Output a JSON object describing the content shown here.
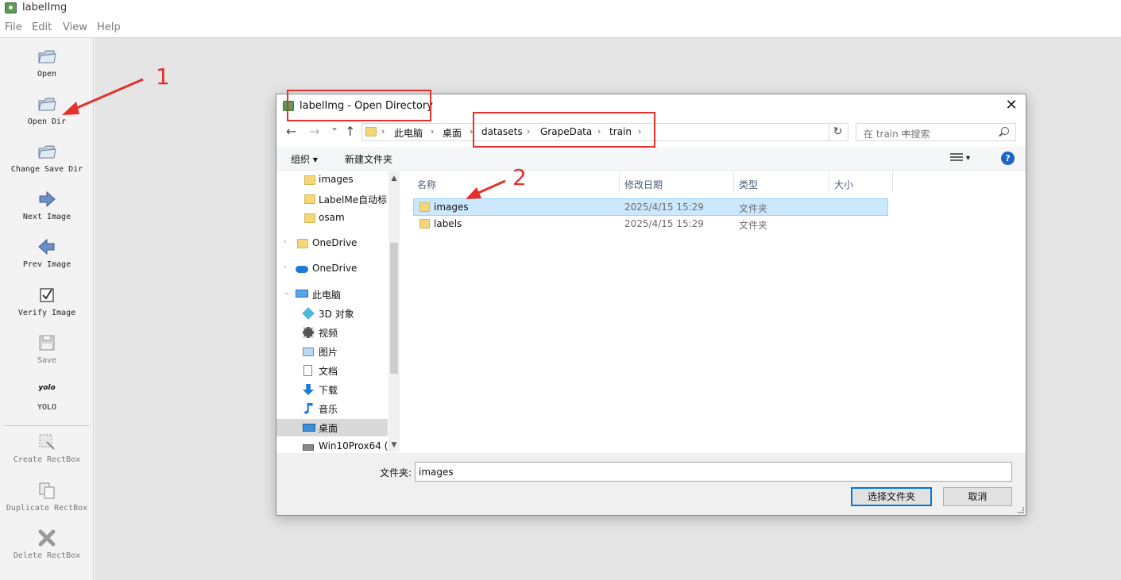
{
  "app": {
    "title": "labelImg"
  },
  "menu": [
    "File",
    "Edit",
    "View",
    "Help"
  ],
  "toolbar": {
    "open": "Open",
    "open_dir": "Open Dir",
    "change_save_dir": "Change Save Dir",
    "next_image": "Next Image",
    "prev_image": "Prev Image",
    "verify_image": "Verify Image",
    "save": "Save",
    "yolo_badge": "yolo",
    "yolo": "YOLO",
    "create_rectbox": "Create RectBox",
    "duplicate_rectbox": "Duplicate RectBox",
    "delete_rectbox": "Delete RectBox"
  },
  "dialog": {
    "title": "labelImg - Open Directory",
    "close": "✕",
    "nav": {
      "back": "←",
      "forward": "→",
      "recent": "⌄",
      "up": "↑"
    },
    "breadcrumb": [
      "此电脑",
      "桌面",
      "datasets",
      "GrapeData",
      "train"
    ],
    "breadcrumb_sep": "›",
    "search_placeholder": "在 train 中搜索",
    "commands": {
      "organize": "组织 ▾",
      "new_folder": "新建文件夹",
      "view_drop": "▾",
      "help": "?"
    },
    "nav_items": [
      {
        "label": "images",
        "icon": "folder-icon"
      },
      {
        "label": "LabelMe自动标",
        "icon": "folder-icon"
      },
      {
        "label": "osam",
        "icon": "folder-icon"
      },
      {
        "label": "OneDrive",
        "icon": "folder-icon"
      },
      {
        "label": "OneDrive",
        "icon": "cloud-icon"
      },
      {
        "label": "此电脑",
        "icon": "computer-icon"
      },
      {
        "label": "3D 对象",
        "icon": "cube-icon"
      },
      {
        "label": "视频",
        "icon": "video-icon"
      },
      {
        "label": "图片",
        "icon": "picture-icon"
      },
      {
        "label": "文档",
        "icon": "document-icon"
      },
      {
        "label": "下载",
        "icon": "download-icon"
      },
      {
        "label": "音乐",
        "icon": "music-icon"
      },
      {
        "label": "桌面",
        "icon": "desktop-icon"
      },
      {
        "label": "Win10Prox64 (",
        "icon": "drive-icon"
      }
    ],
    "columns": [
      "名称",
      "修改日期",
      "类型",
      "大小"
    ],
    "files": [
      {
        "name": "images",
        "date": "2025/4/15 15:29",
        "type": "文件夹",
        "selected": true
      },
      {
        "name": "labels",
        "date": "2025/4/15 15:29",
        "type": "文件夹",
        "selected": false
      }
    ],
    "folder_label": "文件夹:",
    "folder_value": "images",
    "select_button": "选择文件夹",
    "cancel_button": "取消"
  },
  "annotations": {
    "step1": "1",
    "step2": "2",
    "color": "#e5302b"
  }
}
